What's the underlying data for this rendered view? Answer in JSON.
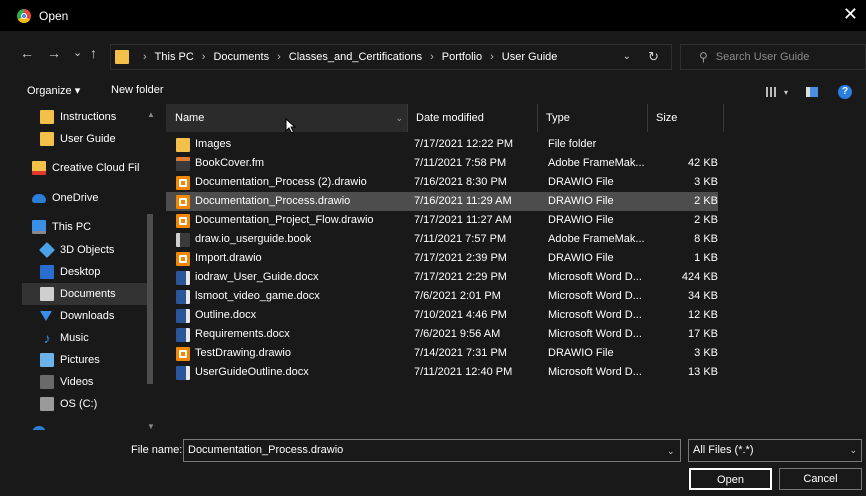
{
  "window": {
    "title": "Open",
    "close_glyph": "✕"
  },
  "nav_buttons": {
    "back": "←",
    "forward": "→",
    "recent": "⌄",
    "up": "↑"
  },
  "breadcrumb": [
    "This PC",
    "Documents",
    "Classes_and_Certifications",
    "Portfolio",
    "User Guide"
  ],
  "breadcrumb_separator": "›",
  "search": {
    "placeholder": "Search User Guide",
    "icon": "search-icon"
  },
  "toolbar": {
    "organize_label": "Organize ▾",
    "new_folder_label": "New folder",
    "help_label": "?"
  },
  "sidebar": {
    "items": [
      {
        "label": "Instructions",
        "icon": "folder-icon",
        "indent": true
      },
      {
        "label": "User Guide",
        "icon": "folder-icon",
        "indent": true
      },
      {
        "label": "Creative Cloud Fil",
        "icon": "creative-cloud-icon"
      },
      {
        "label": "OneDrive",
        "icon": "cloud-icon"
      },
      {
        "label": "This PC",
        "icon": "computer-icon"
      },
      {
        "label": "3D Objects",
        "icon": "cube-icon",
        "indent": true
      },
      {
        "label": "Desktop",
        "icon": "desktop-icon",
        "indent": true
      },
      {
        "label": "Documents",
        "icon": "documents-icon",
        "indent": true,
        "selected": true
      },
      {
        "label": "Downloads",
        "icon": "download-icon",
        "indent": true
      },
      {
        "label": "Music",
        "icon": "music-icon",
        "indent": true
      },
      {
        "label": "Pictures",
        "icon": "pictures-icon",
        "indent": true
      },
      {
        "label": "Videos",
        "icon": "videos-icon",
        "indent": true
      },
      {
        "label": "OS (C:)",
        "icon": "drive-icon",
        "indent": true
      }
    ]
  },
  "columns": {
    "name": "Name",
    "date": "Date modified",
    "type": "Type",
    "size": "Size"
  },
  "files": [
    {
      "name": "Images",
      "date": "7/17/2021 12:22 PM",
      "type": "File folder",
      "size": "",
      "icon": "folder"
    },
    {
      "name": "BookCover.fm",
      "date": "7/11/2021 7:58 PM",
      "type": "Adobe FrameMak...",
      "size": "42 KB",
      "icon": "fm"
    },
    {
      "name": "Documentation_Process (2).drawio",
      "date": "7/16/2021 8:30 PM",
      "type": "DRAWIO File",
      "size": "3 KB",
      "icon": "drawio"
    },
    {
      "name": "Documentation_Process.drawio",
      "date": "7/16/2021 11:29 AM",
      "type": "DRAWIO File",
      "size": "2 KB",
      "icon": "drawio",
      "selected": true
    },
    {
      "name": "Documentation_Project_Flow.drawio",
      "date": "7/17/2021 11:27 AM",
      "type": "DRAWIO File",
      "size": "2 KB",
      "icon": "drawio"
    },
    {
      "name": "draw.io_userguide.book",
      "date": "7/11/2021 7:57 PM",
      "type": "Adobe FrameMak...",
      "size": "8 KB",
      "icon": "book"
    },
    {
      "name": "Import.drawio",
      "date": "7/17/2021 2:39 PM",
      "type": "DRAWIO File",
      "size": "1 KB",
      "icon": "drawio"
    },
    {
      "name": "iodraw_User_Guide.docx",
      "date": "7/17/2021 2:29 PM",
      "type": "Microsoft Word D...",
      "size": "424 KB",
      "icon": "word"
    },
    {
      "name": "lsmoot_video_game.docx",
      "date": "7/6/2021 2:01 PM",
      "type": "Microsoft Word D...",
      "size": "34 KB",
      "icon": "word"
    },
    {
      "name": "Outline.docx",
      "date": "7/10/2021 4:46 PM",
      "type": "Microsoft Word D...",
      "size": "12 KB",
      "icon": "word"
    },
    {
      "name": "Requirements.docx",
      "date": "7/6/2021 9:56 AM",
      "type": "Microsoft Word D...",
      "size": "17 KB",
      "icon": "word"
    },
    {
      "name": "TestDrawing.drawio",
      "date": "7/14/2021 7:31 PM",
      "type": "DRAWIO File",
      "size": "3 KB",
      "icon": "drawio"
    },
    {
      "name": "UserGuideOutline.docx",
      "date": "7/11/2021 12:40 PM",
      "type": "Microsoft Word D...",
      "size": "13 KB",
      "icon": "word"
    }
  ],
  "footer": {
    "file_name_label": "File name:",
    "file_name_value": "Documentation_Process.drawio",
    "filter_value": "All Files (*.*)",
    "open_label": "Open",
    "cancel_label": "Cancel"
  }
}
